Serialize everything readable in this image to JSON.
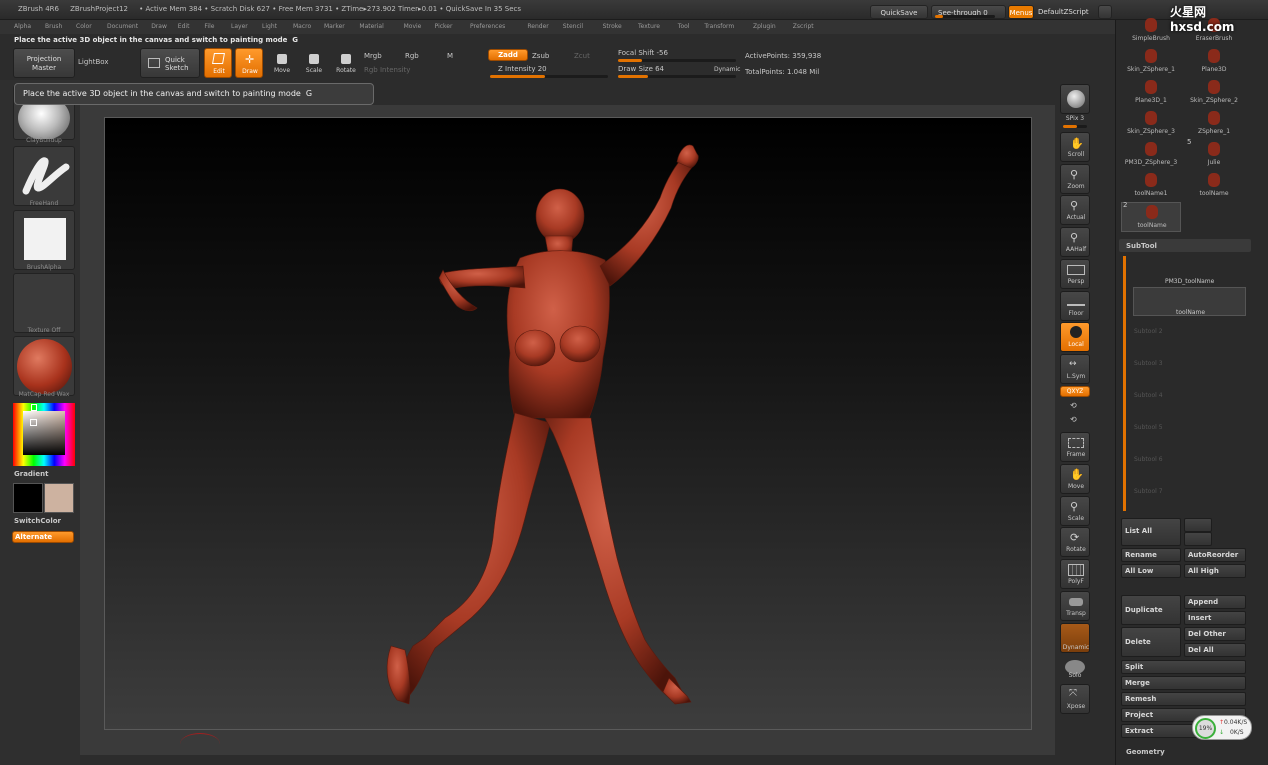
{
  "titlebar": {
    "text": "ZBrush 4R6     ZBrushProject12     • Active Mem 384 • Scratch Disk 627 • Free Mem 3731 • ZTime▸273.902 Timer▸0.01 • QuickSave In 35 Secs",
    "quicksave": "QuickSave",
    "seethrough": "See-through  0",
    "menus": "Menus",
    "script": "DefaultZScript"
  },
  "menus": [
    "Alpha",
    "Brush",
    "Color",
    "Document",
    "Draw",
    "Edit",
    "File",
    "Layer",
    "Light",
    "Macro",
    "Marker",
    "Material",
    "Movie",
    "Picker",
    "Preferences",
    "Render",
    "Stencil",
    "Stroke",
    "Texture",
    "Tool",
    "Transform",
    "Zplugin",
    "Zscript"
  ],
  "hint": "Place the active 3D object in the canvas and switch to painting mode  G",
  "toolbar": {
    "projection_master": [
      "Projection",
      "Master"
    ],
    "lightbox": "LightBox",
    "quick_sketch": [
      "Quick",
      "Sketch"
    ],
    "edit": "Edit",
    "draw": "Draw",
    "move": "Move",
    "scale": "Scale",
    "rotate": "Rotate",
    "mrgb": "Mrgb",
    "rgb": "Rgb",
    "m": "M",
    "rgb_intensity": "Rgb Intensity",
    "zadd": "Zadd",
    "zsub": "Zsub",
    "zcut": "Zcut",
    "z_intensity": "Z Intensity 20",
    "focal_shift": "Focal Shift -56",
    "draw_size": "Draw Size 64",
    "dynamic": "Dynamic",
    "active_points": "ActivePoints: 359,938",
    "total_points": "TotalPoints: 1.048 Mil"
  },
  "tooltip": "Place the active 3D object in the canvas and switch to painting mode  G",
  "left": {
    "brush": "ClayBuildup",
    "stroke": "FreeHand",
    "alpha": "BrushAlpha",
    "texture": "Texture Off",
    "material": "MatCap Red Wax",
    "gradient": "Gradient",
    "switchcolor": "SwitchColor",
    "alternate": "Alternate"
  },
  "right": {
    "bpr": "BPR",
    "spix": "SPix 3",
    "scroll": "Scroll",
    "zoom": "Zoom",
    "actual": "Actual",
    "aahalf": "AAHalf",
    "persp": "Persp",
    "floor": "Floor",
    "local": "Local",
    "lsym": "L.Sym",
    "xyz": "QXYZ",
    "frame": "Frame",
    "move": "Move",
    "scale": "Scale",
    "rotate": "Rotate",
    "polyf": "PolyF",
    "transp": "Transp",
    "ghost": "Dynamic",
    "solo": "Solo",
    "xpose": "Xpose"
  },
  "tray": {
    "tools": [
      [
        "SimpleBrush",
        "EraserBrush"
      ],
      [
        "Skin_ZSphere_1",
        "Plane3D"
      ],
      [
        "Plane3D_1",
        "Skin_ZSphere_2"
      ],
      [
        "Skin_ZSphere_3",
        "ZSphere_1"
      ],
      [
        "PM3D_ZSphere_3",
        "Julie"
      ],
      [
        "toolName1",
        "toolName"
      ],
      [
        "toolName",
        ""
      ]
    ],
    "tool_num_5": "5",
    "tool_num_2": "2",
    "subtool": "SubTool",
    "sub1": "PM3D_toolName",
    "sub2": "toolName",
    "empties": [
      "Subtool 2",
      "Subtool 3",
      "Subtool 4",
      "Subtool 5",
      "Subtool 6",
      "Subtool 7"
    ],
    "list_all": "List All",
    "rename": "Rename",
    "autoreorder": "AutoReorder",
    "all_low": "All Low",
    "all_high": "All High",
    "duplicate": "Duplicate",
    "append": "Append",
    "insert": "Insert",
    "delete": "Delete",
    "del_other": "Del Other",
    "del_all": "Del All",
    "split": "Split",
    "merge": "Merge",
    "remesh": "Remesh",
    "project": "Project",
    "extract": "Extract",
    "geometry": "Geometry"
  },
  "netmon": {
    "cpu": "19%",
    "up": "0.04K/S",
    "down": "0K/S"
  },
  "logo": "火星网 hxsd.com",
  "colors": {
    "accent": "#e87a00",
    "model": "#b83a22"
  }
}
